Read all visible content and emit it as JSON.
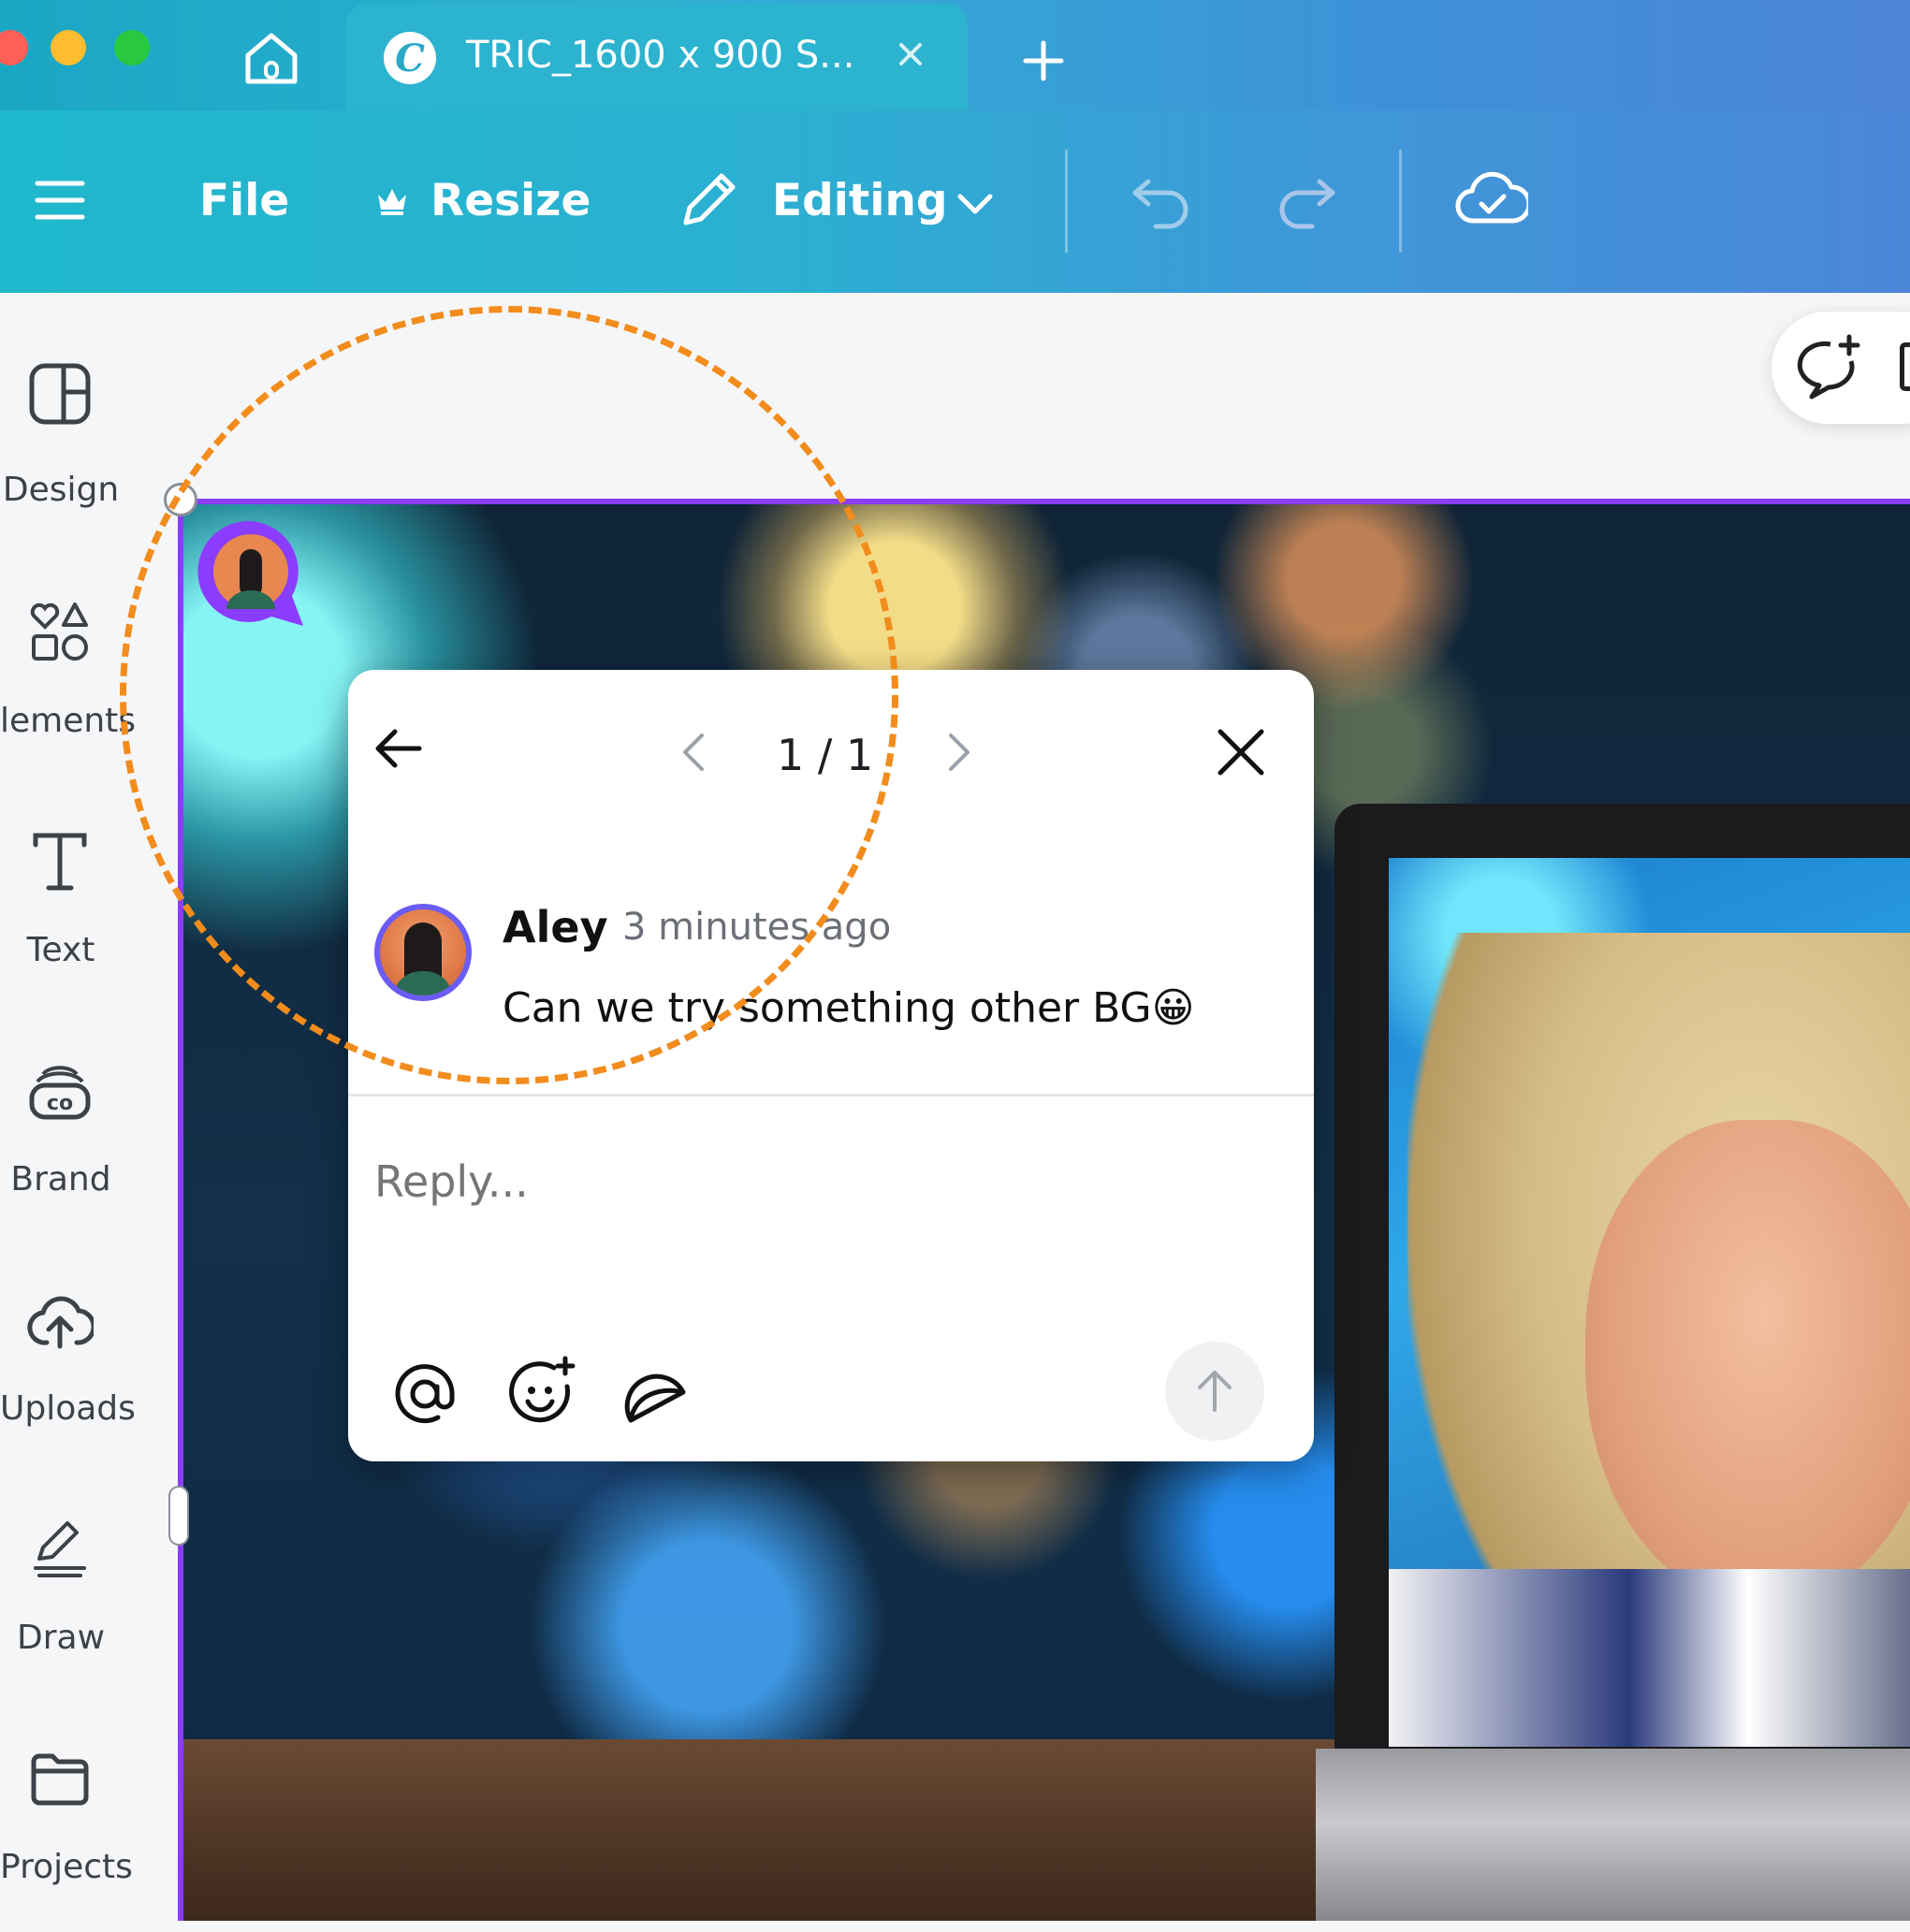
{
  "window": {
    "traffic_lights": [
      "#ff5f57",
      "#febc2e",
      "#28c840"
    ]
  },
  "tab": {
    "logo_letter": "C",
    "title": "TRIC_1600 x 900 S..."
  },
  "toolbar": {
    "file_label": "File",
    "resize_label": "Resize",
    "editing_label": "Editing"
  },
  "sidebar": {
    "items": [
      {
        "label": "Design",
        "icon": "layout-icon"
      },
      {
        "label": "lements",
        "icon": "shapes-icon"
      },
      {
        "label": "Text",
        "icon": "text-icon"
      },
      {
        "label": "Brand",
        "icon": "brand-icon"
      },
      {
        "label": "Uploads",
        "icon": "cloud-upload-icon"
      },
      {
        "label": "Draw",
        "icon": "pen-icon"
      },
      {
        "label": "Projects",
        "icon": "folder-icon"
      }
    ]
  },
  "comment": {
    "pager": "1 / 1",
    "author": "Aley",
    "time": "3 minutes ago",
    "message": "Can we try something other BG😀",
    "reply_placeholder": "Reply..."
  },
  "colors": {
    "accent": "#8b3dff",
    "annotation": "#f28c1c",
    "toolbar_start": "#1fb8cc",
    "toolbar_end": "#4b86d9"
  }
}
